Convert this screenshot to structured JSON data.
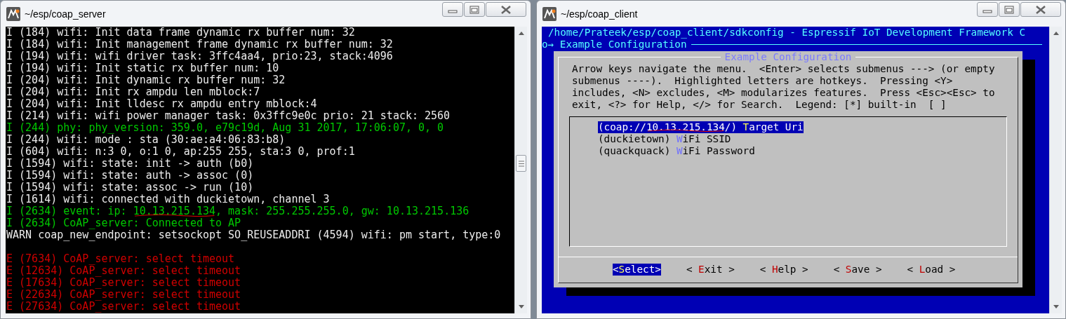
{
  "windows": [
    {
      "kind": "terminal",
      "title": "~/esp/coap_server",
      "blocks": [
        {
          "lines": [
            {
              "parts": [
                {
                  "text": "I (184) wifi: Init data frame dynamic rx buffer num: 32",
                  "scribbled": false
                }
              ],
              "kind": "normal"
            },
            {
              "parts": [
                {
                  "text": "I (184) wifi: Init management frame dynamic rx buffer num: 32",
                  "scribbled": false
                }
              ],
              "kind": "normal"
            },
            {
              "parts": [
                {
                  "text": "I (194) wifi: wifi driver task: 3ffc4aa4, prio:23, stack:4096",
                  "scribbled": false
                }
              ],
              "kind": "normal"
            },
            {
              "parts": [
                {
                  "text": "I (194) wifi: Init static rx buffer num: 10",
                  "scribbled": false
                }
              ],
              "kind": "normal"
            },
            {
              "parts": [
                {
                  "text": "I (204) wifi: Init dynamic rx buffer num: 32",
                  "scribbled": false
                }
              ],
              "kind": "normal"
            },
            {
              "parts": [
                {
                  "text": "I (204) wifi: Init rx ampdu len mblock:7",
                  "scribbled": false
                }
              ],
              "kind": "normal"
            },
            {
              "parts": [
                {
                  "text": "I (204) wifi: Init lldesc rx ampdu entry mblock:4",
                  "scribbled": false
                }
              ],
              "kind": "normal"
            },
            {
              "parts": [
                {
                  "text": "I (214) wifi: wifi power manager task: 0x3ffc9e0c prio: 21 stack: 2560",
                  "scribbled": false
                }
              ],
              "kind": "normal"
            },
            {
              "parts": [
                {
                  "text": "I (244) phy: phy_version: 359.0, e79c19d, Aug 31 2017, 17:06:07, 0, 0",
                  "scribbled": false
                }
              ],
              "kind": "highlight"
            },
            {
              "parts": [
                {
                  "text": "I (244) wifi: mode : sta (30:ae:a4:06:83:b8)",
                  "scribbled": false
                }
              ],
              "kind": "normal"
            },
            {
              "parts": [
                {
                  "text": "I (604) wifi: n:3 0, o:1 0, ap:255 255, sta:3 0, prof:1",
                  "scribbled": false
                }
              ],
              "kind": "normal"
            },
            {
              "parts": [
                {
                  "text": "I (1594) wifi: state: init -> auth (b0)",
                  "scribbled": false
                }
              ],
              "kind": "normal"
            },
            {
              "parts": [
                {
                  "text": "I (1594) wifi: state: auth -> assoc (0)",
                  "scribbled": false
                }
              ],
              "kind": "normal"
            },
            {
              "parts": [
                {
                  "text": "I (1594) wifi: state: assoc -> run (10)",
                  "scribbled": false
                }
              ],
              "kind": "normal"
            },
            {
              "parts": [
                {
                  "text": "I (1614) wifi: connected with duckietown, channel 3",
                  "scribbled": false
                }
              ],
              "kind": "normal"
            },
            {
              "parts": [
                {
                  "text": "I (2634) event: ip: ",
                  "scribbled": false
                },
                {
                  "text": "10.13.215.134",
                  "scribbled": true
                },
                {
                  "text": ", mask: 255.255.255.0, gw: 10.13.215.136",
                  "scribbled": false
                }
              ],
              "kind": "highlight"
            },
            {
              "parts": [
                {
                  "text": "I (2634) CoAP_server: Connected to AP",
                  "scribbled": false
                }
              ],
              "kind": "highlight"
            },
            {
              "parts": [
                {
                  "text": "WARN coap_new_endpoint: setsockopt SO_REUSEADDRI (4594) wifi: pm start, type:0",
                  "scribbled": false
                }
              ],
              "kind": "normal"
            }
          ]
        },
        {
          "lines": [
            {
              "parts": [
                {
                  "text": "E (7634) CoAP_server: select timeout",
                  "scribbled": false
                }
              ],
              "kind": "error"
            },
            {
              "parts": [
                {
                  "text": "E (12634) CoAP_server: select timeout",
                  "scribbled": false
                }
              ],
              "kind": "error"
            },
            {
              "parts": [
                {
                  "text": "E (17634) CoAP_server: select timeout",
                  "scribbled": false
                }
              ],
              "kind": "error"
            },
            {
              "parts": [
                {
                  "text": "E (22634) CoAP_server: select timeout",
                  "scribbled": false
                }
              ],
              "kind": "error"
            },
            {
              "parts": [
                {
                  "text": "E (27634) CoAP_server: select timeout",
                  "scribbled": false
                }
              ],
              "kind": "error"
            }
          ]
        }
      ]
    },
    {
      "kind": "menuconfig",
      "title": "~/esp/coap_client",
      "header": "/home/Prateek/esp/coap_client/sdkconfig - Espressif IoT Development Framework C",
      "breadcrumb": "o→ Example Configuration",
      "dialog": {
        "title": "Example Configuration",
        "help": [
          "Arrow keys navigate the menu.  <Enter> selects submenus ---> (or empty",
          "submenus ----).  Highlighted letters are hotkeys.  Pressing <Y>",
          "includes, <N> excludes, <M> modularizes features.  Press <Esc><Esc> to",
          "exit, <?> for Help, </> for Search.  Legend: [*] built-in  [ ]"
        ],
        "items": [
          {
            "value_parts": [
              {
                "text": "(coap://",
                "scribbled": false
              },
              {
                "text": "10.13.215.134",
                "scribbled": true
              },
              {
                "text": "/)",
                "scribbled": false
              }
            ],
            "hotkey": "T",
            "label": "arget Uri",
            "selected": true
          },
          {
            "value_parts": [
              {
                "text": "(duckietown)",
                "scribbled": false
              }
            ],
            "hotkey": "W",
            "label": "iFi SSID",
            "selected": false
          },
          {
            "value_parts": [
              {
                "text": "(quackquack)",
                "scribbled": false
              }
            ],
            "hotkey": "W",
            "label": "iFi Password",
            "selected": false
          }
        ],
        "buttons": [
          {
            "before": "<",
            "hotkey": "S",
            "after": "elect>",
            "selected": true
          },
          {
            "before": "< ",
            "hotkey": "E",
            "after": "xit >",
            "selected": false
          },
          {
            "before": "< ",
            "hotkey": "H",
            "after": "elp >",
            "selected": false
          },
          {
            "before": "< ",
            "hotkey": "S",
            "after": "ave >",
            "selected": false
          },
          {
            "before": "< ",
            "hotkey": "L",
            "after": "oad >",
            "selected": false
          }
        ]
      }
    }
  ]
}
